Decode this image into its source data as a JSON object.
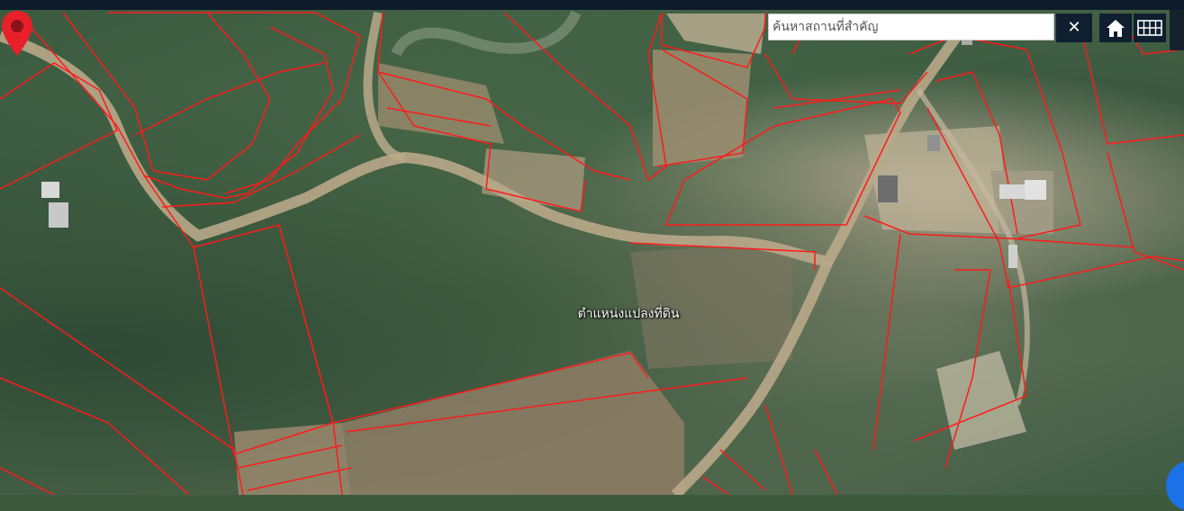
{
  "search": {
    "placeholder": "ค้นหาสถานที่สำคัญ"
  },
  "controls": {
    "close_icon": "close-icon",
    "home_icon": "home-icon",
    "grid_icon": "grid-icon"
  },
  "marker": {
    "label": "ตำแหน่งแปลงที่ดิน",
    "icon": "map-pin-icon",
    "color": "#e8202a"
  },
  "colors": {
    "parcel_outline": "#ff1a1a",
    "toolbar_bg": "#0f1f30",
    "fab_blue": "#1b72e8"
  }
}
